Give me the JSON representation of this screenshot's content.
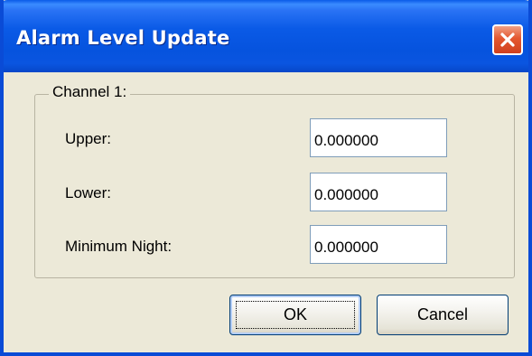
{
  "window": {
    "title": "Alarm Level Update"
  },
  "titlebar": {
    "close_icon": "close-icon"
  },
  "group": {
    "label": "Channel 1:"
  },
  "fields": {
    "upper": {
      "label": "Upper:",
      "value": "0.000000"
    },
    "lower": {
      "label": "Lower:",
      "value": "0.000000"
    },
    "minimum_night": {
      "label": "Minimum Night:",
      "value": "0.000000"
    }
  },
  "buttons": {
    "ok_label": "OK",
    "cancel_label": "Cancel"
  },
  "colors": {
    "titlebar": "#0a5ae6",
    "close_button": "#e4572f",
    "dialog_face": "#ece9d8",
    "button_border": "#003c74",
    "input_border": "#7f9db9"
  }
}
